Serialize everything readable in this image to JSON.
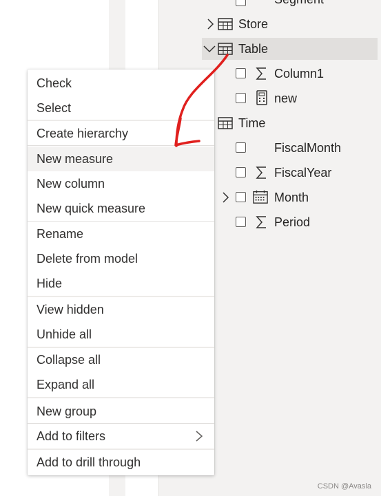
{
  "fields_pane": {
    "rows": [
      {
        "label": "Segment"
      },
      {
        "label": "Store"
      },
      {
        "label": "Table"
      },
      {
        "label": "Column1"
      },
      {
        "label": "new"
      },
      {
        "label": "Time"
      },
      {
        "label": "FiscalMonth"
      },
      {
        "label": "FiscalYear"
      },
      {
        "label": "Month"
      },
      {
        "label": "Period"
      }
    ]
  },
  "context_menu": {
    "items": [
      {
        "label": "Check"
      },
      {
        "label": "Select"
      },
      {
        "label": "Create hierarchy"
      },
      {
        "label": "New measure"
      },
      {
        "label": "New column"
      },
      {
        "label": "New quick measure"
      },
      {
        "label": "Rename"
      },
      {
        "label": "Delete from model"
      },
      {
        "label": "Hide"
      },
      {
        "label": "View hidden"
      },
      {
        "label": "Unhide all"
      },
      {
        "label": "Collapse all"
      },
      {
        "label": "Expand all"
      },
      {
        "label": "New group"
      },
      {
        "label": "Add to filters"
      },
      {
        "label": "Add to drill through"
      }
    ]
  },
  "annotation": {
    "color": "#e0201e"
  },
  "watermark": "CSDN @Avasla"
}
